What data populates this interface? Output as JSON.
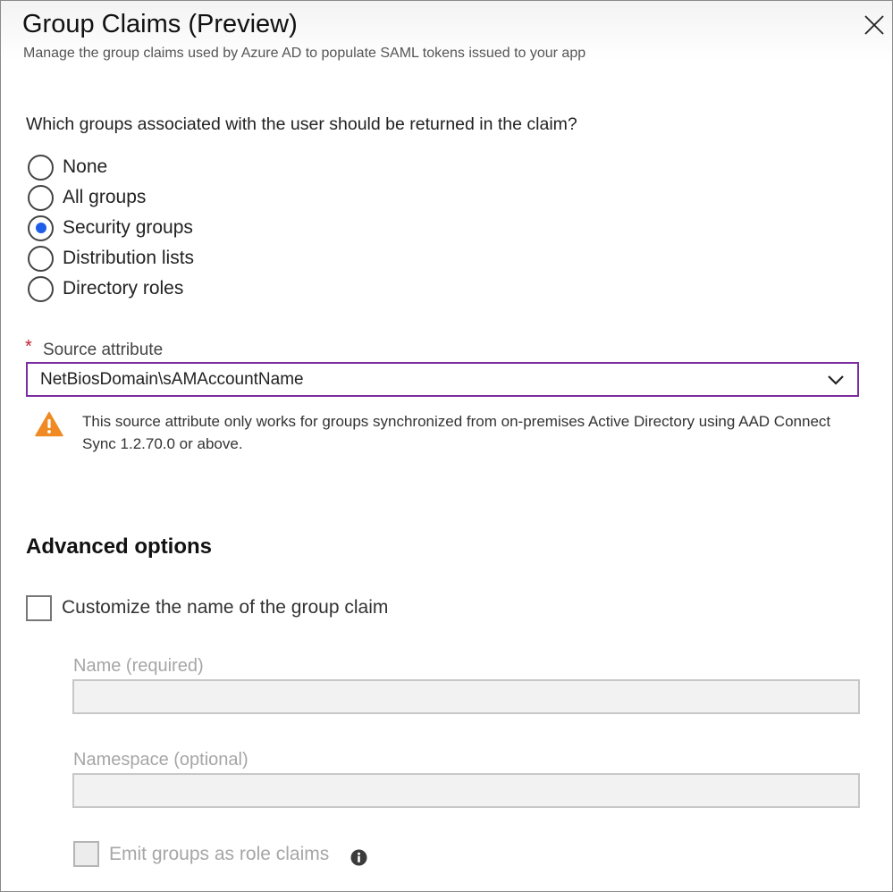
{
  "header": {
    "title": "Group Claims (Preview)",
    "subtitle": "Manage the group claims used by Azure AD to populate SAML tokens issued to your app"
  },
  "question": "Which groups associated with the user should be returned in the claim?",
  "group_options": [
    {
      "label": "None",
      "selected": false
    },
    {
      "label": "All groups",
      "selected": false
    },
    {
      "label": "Security groups",
      "selected": true
    },
    {
      "label": "Distribution lists",
      "selected": false
    },
    {
      "label": "Directory roles",
      "selected": false
    }
  ],
  "source_attribute": {
    "required_marker": "*",
    "label": "Source attribute",
    "value": "NetBiosDomain\\sAMAccountName"
  },
  "warning": {
    "icon": "warning-triangle-icon",
    "text": "This source attribute only works for groups synchronized from on-premises Active Directory using AAD Connect Sync 1.2.70.0 or above."
  },
  "advanced": {
    "title": "Advanced options",
    "customize_label": "Customize the name of the group claim",
    "customize_checked": false,
    "name_label": "Name (required)",
    "name_value": "",
    "namespace_label": "Namespace (optional)",
    "namespace_value": "",
    "emit_label": "Emit groups as role claims",
    "emit_checked": false
  },
  "colors": {
    "accent_radio": "#1f5ee8",
    "dropdown_focus_border": "#7b2d9e",
    "warning": "#f08a24",
    "required": "#c41f2e"
  }
}
